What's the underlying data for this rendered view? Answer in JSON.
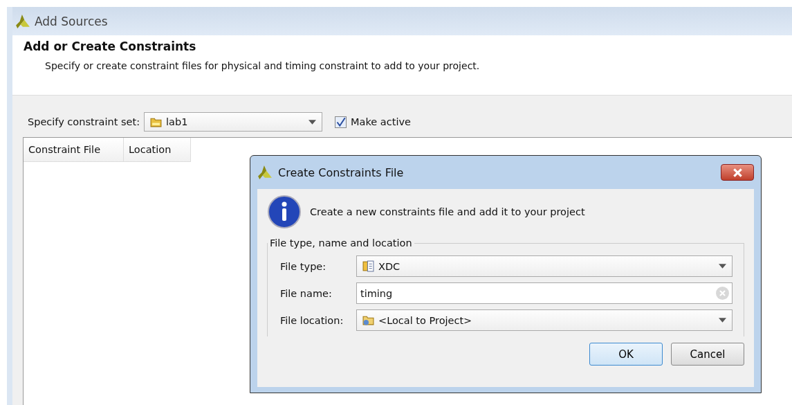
{
  "window": {
    "title": "Add Sources"
  },
  "header": {
    "title": "Add or Create Constraints",
    "description": "Specify or create constraint files for physical and timing constraint to add to your project."
  },
  "constraint_set": {
    "label": "Specify constraint set:",
    "value": "lab1"
  },
  "make_active": {
    "label": "Make active",
    "checked": true
  },
  "table": {
    "columns": [
      "Constraint File",
      "Location"
    ]
  },
  "dialog": {
    "title": "Create Constraints File",
    "message": "Create a new constraints file and add it to your project",
    "group": {
      "title": "File type, name and location",
      "fields": [
        {
          "kind": "dropdown",
          "label": "File type:",
          "value": "XDC"
        },
        {
          "kind": "text",
          "label": "File name:",
          "value": "timing"
        },
        {
          "kind": "dropdown",
          "label": "File location:",
          "value": "<Local to Project>"
        }
      ]
    },
    "buttons": [
      {
        "label": "OK",
        "default": true
      },
      {
        "label": "Cancel",
        "default": false
      }
    ]
  }
}
